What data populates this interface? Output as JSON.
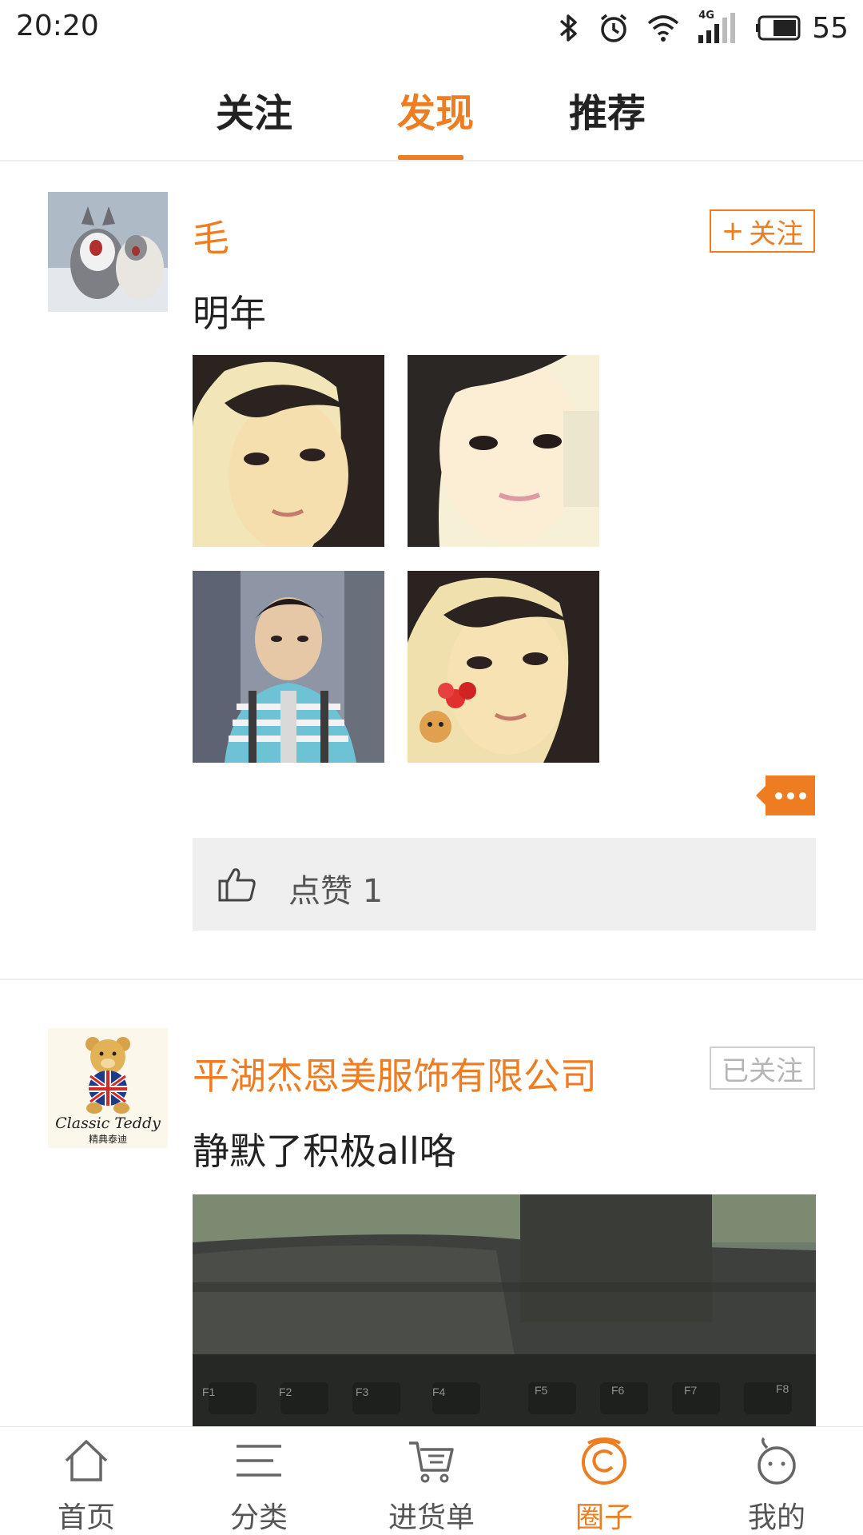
{
  "status_bar": {
    "time": "20:20",
    "network": "4G",
    "battery": "55"
  },
  "top_tabs": {
    "follow": "关注",
    "discover": "发现",
    "recommend": "推荐",
    "active": "discover"
  },
  "posts": [
    {
      "username": "毛",
      "follow_label": "关注",
      "text": "明年",
      "photos": [
        "photo-girl-1",
        "photo-girl-2",
        "photo-boy",
        "photo-girl-3"
      ],
      "likes_label": "点赞",
      "likes_count": "1"
    },
    {
      "username": "平湖杰恩美服饰有限公司",
      "avatar_text": "Classic Teddy",
      "avatar_subtext": "精典泰迪",
      "followed_label": "已关注",
      "text": "静默了积极all咯",
      "keyboard_keys": [
        "F1",
        "F2",
        "F3",
        "F4",
        "F5",
        "F6",
        "F7",
        "F8"
      ]
    }
  ],
  "bottom_nav": {
    "items": [
      {
        "label": "首页",
        "icon": "home-icon"
      },
      {
        "label": "分类",
        "icon": "category-icon"
      },
      {
        "label": "进货单",
        "icon": "cart-icon"
      },
      {
        "label": "圈子",
        "icon": "circle-icon"
      },
      {
        "label": "我的",
        "icon": "profile-icon"
      }
    ],
    "active": 3
  },
  "colors": {
    "accent": "#ee7d22",
    "like_bar": "#efefef",
    "followed_border": "#cfcfcf"
  }
}
